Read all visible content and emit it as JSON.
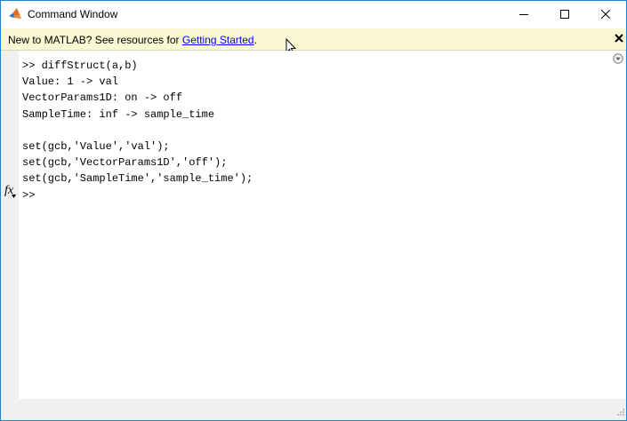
{
  "window": {
    "title": "Command Window",
    "app_icon": "matlab-logo-icon",
    "controls": {
      "minimize_icon": "minimize-icon",
      "maximize_icon": "maximize-icon",
      "close_icon": "close-icon"
    }
  },
  "info_bar": {
    "message": "New to MATLAB? See resources for ",
    "link_text": "Getting Started",
    "suffix": ".",
    "close_icon": "close-icon"
  },
  "console": {
    "lines": [
      ">> diffStruct(a,b)",
      "Value: 1 -> val",
      "VectorParams1D: on -> off",
      "SampleTime: inf -> sample_time",
      "",
      "set(gcb,'Value','val');",
      "set(gcb,'VectorParams1D','off');",
      "set(gcb,'SampleTime','sample_time');",
      ">>"
    ],
    "prompt_icon": "fx-function-browser-icon",
    "options_icon": "chevron-down-circle-icon"
  },
  "colors": {
    "title_border": "#1883d7",
    "info_bar_bg": "#fbf8d4",
    "link": "#0000ee",
    "gutter_bg": "#f0f0f0"
  }
}
